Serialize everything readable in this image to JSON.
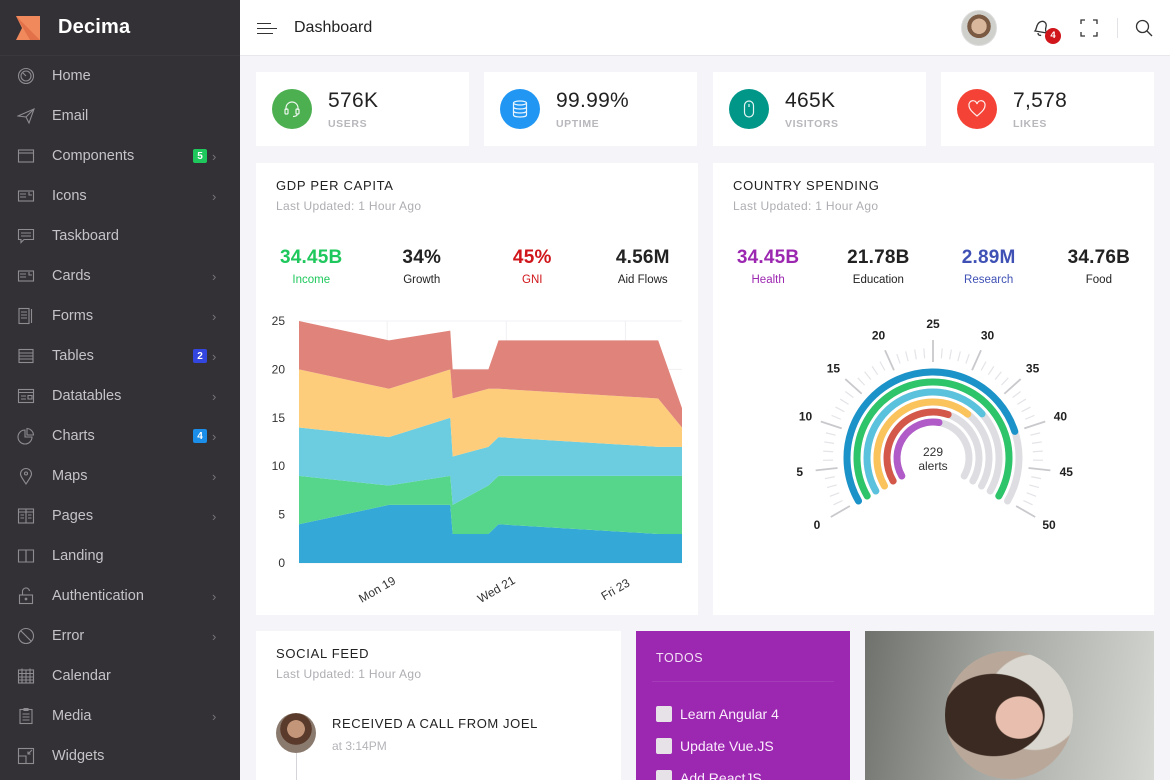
{
  "brand": {
    "name": "Decima",
    "logo_color": "#f08a5d"
  },
  "sidebar": {
    "items": [
      {
        "label": "Home",
        "icon": "dashboard-gauge-icon",
        "badge": null,
        "chevron": false
      },
      {
        "label": "Email",
        "icon": "paper-plane-icon",
        "badge": null,
        "chevron": false
      },
      {
        "label": "Components",
        "icon": "browser-window-icon",
        "badge": "5",
        "badge_color": "#1fc85c",
        "chevron": true
      },
      {
        "label": "Icons",
        "icon": "id-card-icon",
        "badge": null,
        "chevron": true
      },
      {
        "label": "Taskboard",
        "icon": "chat-bubble-icon",
        "badge": null,
        "chevron": false
      },
      {
        "label": "Cards",
        "icon": "cards-icon",
        "badge": null,
        "chevron": true
      },
      {
        "label": "Forms",
        "icon": "form-document-icon",
        "badge": null,
        "chevron": true
      },
      {
        "label": "Tables",
        "icon": "table-list-icon",
        "badge": "2",
        "badge_color": "#3446e0",
        "chevron": true
      },
      {
        "label": "Datatables",
        "icon": "datatable-icon",
        "badge": null,
        "chevron": true
      },
      {
        "label": "Charts",
        "icon": "pie-chart-icon",
        "badge": "4",
        "badge_color": "#1a8ee8",
        "chevron": true
      },
      {
        "label": "Maps",
        "icon": "map-pin-icon",
        "badge": null,
        "chevron": true
      },
      {
        "label": "Pages",
        "icon": "pages-icon",
        "badge": null,
        "chevron": true
      },
      {
        "label": "Landing",
        "icon": "open-book-icon",
        "badge": null,
        "chevron": false
      },
      {
        "label": "Authentication",
        "icon": "unlock-icon",
        "badge": null,
        "chevron": true
      },
      {
        "label": "Error",
        "icon": "ban-icon",
        "badge": null,
        "chevron": true
      },
      {
        "label": "Calendar",
        "icon": "calendar-icon",
        "badge": null,
        "chevron": false
      },
      {
        "label": "Media",
        "icon": "clipboard-icon",
        "badge": null,
        "chevron": true
      },
      {
        "label": "Widgets",
        "icon": "widgets-icon",
        "badge": null,
        "chevron": false
      }
    ]
  },
  "topbar": {
    "title": "Dashboard",
    "notification_count": "4"
  },
  "stats": [
    {
      "value": "576K",
      "label": "USERS",
      "icon": "headset-icon",
      "color": "#4caf50"
    },
    {
      "value": "99.99%",
      "label": "UPTIME",
      "icon": "database-icon",
      "color": "#2196f3"
    },
    {
      "value": "465K",
      "label": "VISITORS",
      "icon": "mouse-icon",
      "color": "#009688"
    },
    {
      "value": "7,578",
      "label": "LIKES",
      "icon": "heart-icon",
      "color": "#f44336"
    }
  ],
  "gdp_panel": {
    "title": "GDP PER CAPITA",
    "subtitle": "Last Updated: 1 Hour Ago",
    "kpis": [
      {
        "value": "34.45B",
        "label": "Income",
        "value_color": "#1fc85c",
        "label_color": "#1fc85c"
      },
      {
        "value": "34%",
        "label": "Growth",
        "value_color": "#222222",
        "label_color": "#222222"
      },
      {
        "value": "45%",
        "label": "GNI",
        "value_color": "#d0161b",
        "label_color": "#d0161b"
      },
      {
        "value": "4.56M",
        "label": "Aid Flows",
        "value_color": "#222222",
        "label_color": "#222222"
      }
    ]
  },
  "spending_panel": {
    "title": "COUNTRY SPENDING",
    "subtitle": "Last Updated: 1 Hour Ago",
    "kpis": [
      {
        "value": "34.45B",
        "label": "Health",
        "value_color": "#9c27b0",
        "label_color": "#9c27b0"
      },
      {
        "value": "21.78B",
        "label": "Education",
        "value_color": "#222222",
        "label_color": "#222222"
      },
      {
        "value": "2.89M",
        "label": "Research",
        "value_color": "#3f51b5",
        "label_color": "#3f51b5"
      },
      {
        "value": "34.76B",
        "label": "Food",
        "value_color": "#222222",
        "label_color": "#222222"
      }
    ]
  },
  "chart_data": [
    {
      "type": "area",
      "stacked": true,
      "title": "GDP PER CAPITA",
      "x_unit": "day of month",
      "x": [
        17.52,
        19.03,
        20.06,
        20.1,
        20.7,
        20.87,
        23.55,
        23.95
      ],
      "xlim": [
        17.52,
        23.95
      ],
      "xticks": [
        19,
        21,
        23
      ],
      "xtick_labels": [
        "Mon 19",
        "Wed 21",
        "Fri 23"
      ],
      "ylim": [
        0,
        25
      ],
      "yticks": [
        0,
        5,
        10,
        15,
        20,
        25
      ],
      "grid": true,
      "series": [
        {
          "name": "series-1",
          "color": "#34a8d6",
          "values": [
            4,
            6,
            6,
            3,
            3,
            4,
            3,
            3
          ]
        },
        {
          "name": "series-2",
          "color": "#56d68a",
          "values": [
            5,
            2,
            3,
            3,
            5,
            5,
            6,
            6
          ]
        },
        {
          "name": "series-3",
          "color": "#6ccde0",
          "values": [
            5,
            5,
            6,
            5,
            4,
            4,
            3,
            3
          ]
        },
        {
          "name": "series-4",
          "color": "#fdcd7b",
          "values": [
            6,
            5,
            5,
            6,
            6,
            5,
            5,
            2
          ]
        },
        {
          "name": "series-5",
          "color": "#e0837a",
          "values": [
            5,
            5,
            4,
            3,
            2,
            5,
            6,
            2
          ]
        }
      ]
    },
    {
      "type": "radial-gauge",
      "title": "COUNTRY SPENDING",
      "center_value": "229",
      "center_label": "alerts",
      "scale_min": 0,
      "scale_max": 50,
      "scale_ticks": [
        0,
        5,
        10,
        15,
        20,
        25,
        30,
        35,
        40,
        45,
        50
      ],
      "track_color": "#dedde2",
      "rings": [
        {
          "name": "ring-1",
          "color": "#1b93c9",
          "value": 40
        },
        {
          "name": "ring-2",
          "color": "#2ec46a",
          "value": 50
        },
        {
          "name": "ring-3",
          "color": "#5bc2dd",
          "value": 35
        },
        {
          "name": "ring-4",
          "color": "#fbc35c",
          "value": 33
        },
        {
          "name": "ring-5",
          "color": "#d4584a",
          "value": 29
        },
        {
          "name": "ring-6",
          "color": "#b05bc8",
          "value": 27
        }
      ]
    }
  ],
  "social_feed": {
    "title": "SOCIAL FEED",
    "subtitle": "Last Updated: 1 Hour Ago",
    "items": [
      {
        "title": "RECEIVED A CALL FROM JOEL",
        "time": "at 3:14PM"
      }
    ]
  },
  "todos": {
    "title": "TODOS",
    "items": [
      {
        "label": "Learn Angular 4",
        "done": false
      },
      {
        "label": "Update Vue.JS",
        "done": false
      },
      {
        "label": "Add ReactJS",
        "done": false
      }
    ]
  }
}
